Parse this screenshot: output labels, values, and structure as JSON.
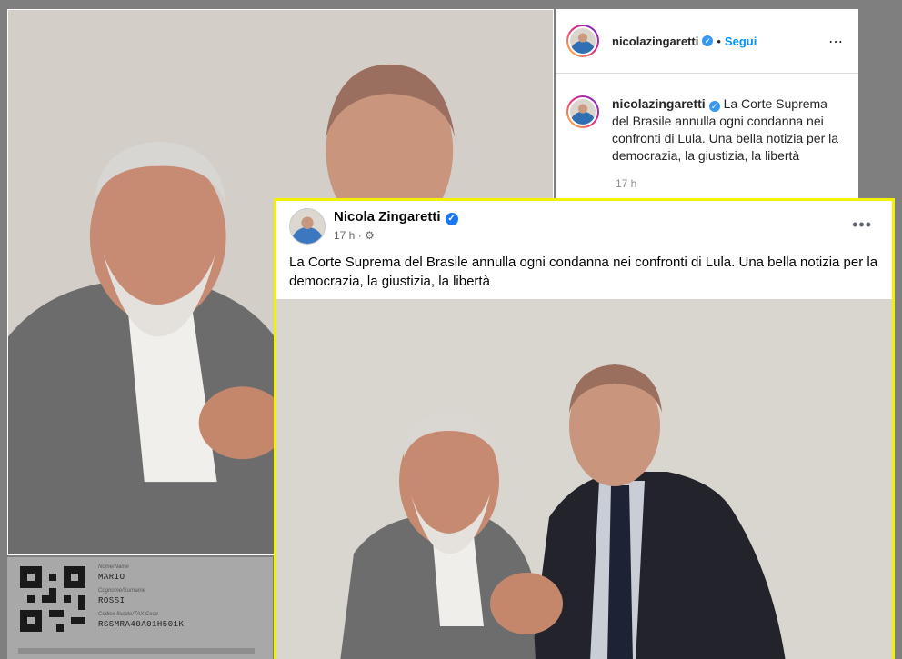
{
  "instagram": {
    "username": "nicolazingaretti",
    "follow_separator": "•",
    "follow_label": "Segui",
    "more_icon": "⋯",
    "caption_user": "nicolazingaretti",
    "caption_text": "La Corte Suprema del Brasile annulla ogni condanna nei confronti di Lula. Una bella notizia per la democrazia, la giustizia, la libertà",
    "time": "17 h",
    "verified_icon": "✓"
  },
  "document": {
    "name_label": "Nome/Name",
    "name_value": "MARIO",
    "surname_label": "Cognome/Surname",
    "surname_value": "ROSSI",
    "code_label": "Codice fiscale/TAX Code",
    "code_value": "RSSMRA40A01H501K"
  },
  "facebook": {
    "name": "Nicola Zingaretti",
    "verified_icon": "✓",
    "time": "17 h ·",
    "privacy_icon": "⚙",
    "more_icon": "•••",
    "post_text": "La Corte Suprema del Brasile annulla ogni condanna nei confronti di Lula. Una bella notizia per la democrazia, la giustizia, la libertà"
  },
  "colors": {
    "highlight_border": "#f2f200",
    "ig_link": "#0095f6",
    "fb_verified": "#1877f2"
  }
}
